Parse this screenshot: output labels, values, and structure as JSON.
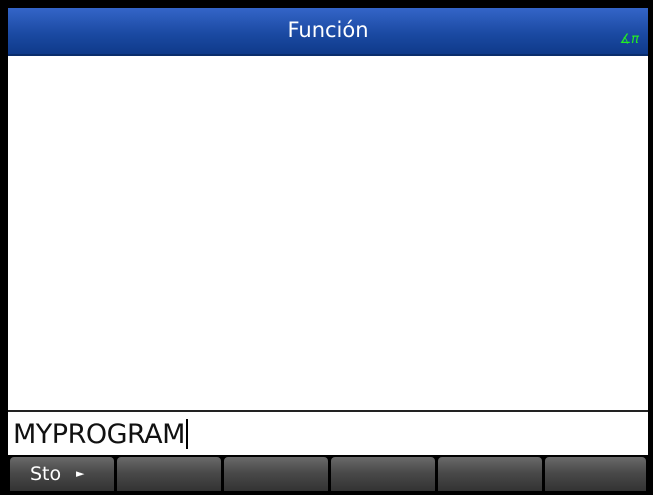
{
  "header": {
    "title": "Función",
    "angle_mode": "∡π"
  },
  "entry": {
    "text": "MYPROGRAM"
  },
  "menu": {
    "keys": [
      {
        "label": "Sto",
        "arrow": "►"
      },
      {
        "label": ""
      },
      {
        "label": ""
      },
      {
        "label": ""
      },
      {
        "label": ""
      },
      {
        "label": ""
      }
    ]
  },
  "colors": {
    "title_bar": "#1b4aa3",
    "angle_indicator": "#22ee22",
    "softkey": "#4a4a4a"
  }
}
